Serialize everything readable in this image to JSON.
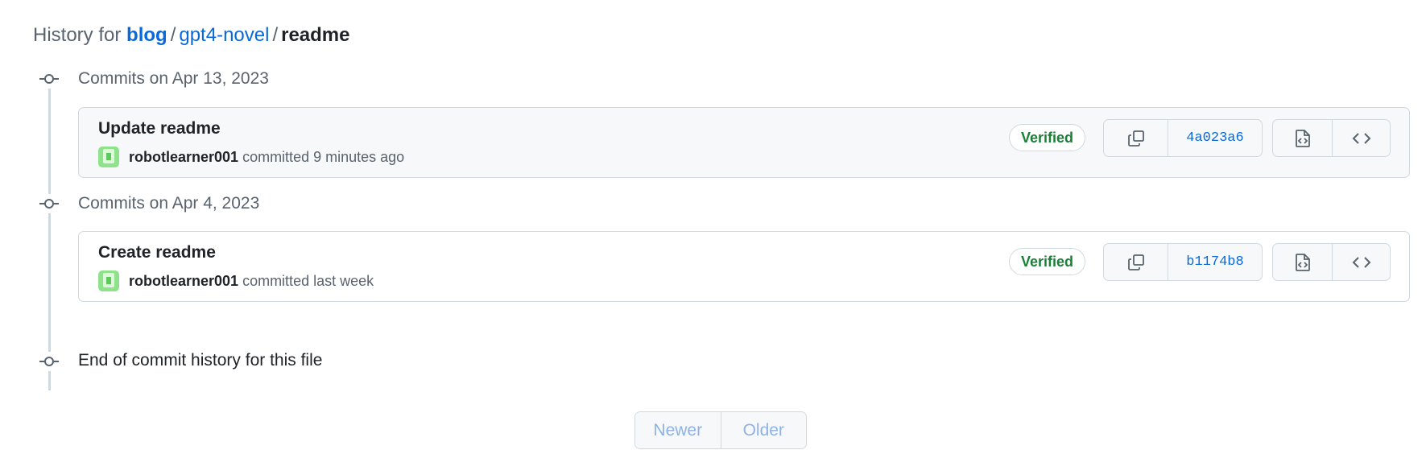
{
  "header": {
    "prefix": "History for",
    "repo": "blog",
    "sep1": "/",
    "folder": "gpt4-novel",
    "sep2": "/",
    "file": "readme"
  },
  "groups": [
    {
      "label": "Commits on Apr 13, 2023",
      "commit": {
        "title": "Update readme",
        "author": "robotlearner001",
        "meta": "committed 9 minutes ago",
        "verified": "Verified",
        "sha": "4a023a6"
      }
    },
    {
      "label": "Commits on Apr 4, 2023",
      "commit": {
        "title": "Create readme",
        "author": "robotlearner001",
        "meta": "committed last week",
        "verified": "Verified",
        "sha": "b1174b8"
      }
    }
  ],
  "end_label": "End of commit history for this file",
  "pagination": {
    "newer": "Newer",
    "older": "Older"
  },
  "icons": {
    "timeline": "git-commit-icon",
    "copy": "copy-icon",
    "browse": "file-code-icon",
    "code": "code-icon"
  },
  "colors": {
    "link": "#0969da",
    "verified": "#1a7f37",
    "muted": "#59636e",
    "border": "#d1d9e0"
  }
}
